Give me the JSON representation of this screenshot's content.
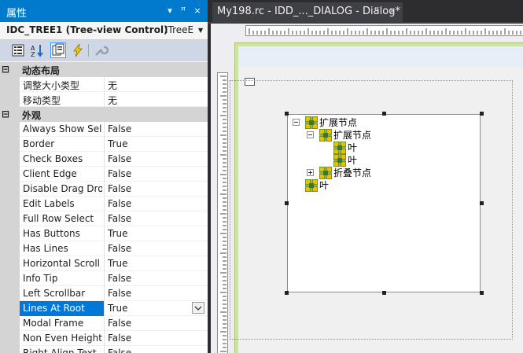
{
  "properties_panel": {
    "title": "属性",
    "title_buttons": {
      "dropdown": "▾",
      "pin": "ꟸ",
      "close": "×"
    },
    "object_name": "IDC_TREE1 (Tree-view Control)",
    "object_type": "ITreeE",
    "categories": [
      {
        "toggle": "⊟",
        "label": "动态布局",
        "props": [
          {
            "name": "调整大小类型",
            "value": "无"
          },
          {
            "name": "移动类型",
            "value": "无"
          }
        ]
      },
      {
        "toggle": "⊟",
        "label": "外观",
        "props": [
          {
            "name": "Always Show Selection",
            "value": "False"
          },
          {
            "name": "Border",
            "value": "True"
          },
          {
            "name": "Check Boxes",
            "value": "False"
          },
          {
            "name": "Client Edge",
            "value": "False"
          },
          {
            "name": "Disable Drag Drop",
            "value": "False"
          },
          {
            "name": "Edit Labels",
            "value": "False"
          },
          {
            "name": "Full Row Select",
            "value": "False"
          },
          {
            "name": "Has Buttons",
            "value": "True"
          },
          {
            "name": "Has Lines",
            "value": "False"
          },
          {
            "name": "Horizontal Scroll",
            "value": "True"
          },
          {
            "name": "Info Tip",
            "value": "False"
          },
          {
            "name": "Left Scrollbar",
            "value": "False"
          },
          {
            "name": "Lines At Root",
            "value": "True"
          },
          {
            "name": "Modal Frame",
            "value": "False"
          },
          {
            "name": "Non Even Height",
            "value": "False"
          },
          {
            "name": "Right Align Text",
            "value": "False"
          }
        ]
      }
    ],
    "selected_property": "Lines At Root"
  },
  "editor": {
    "tab_title": "My198.rc - IDD_..._DIALOG - Dialog*",
    "tab_pin": "ꟸ",
    "tab_close": "×"
  },
  "tree_view": {
    "nodes": [
      {
        "label": "扩展节点",
        "depth": 0,
        "button": "minus"
      },
      {
        "label": "扩展节点",
        "depth": 1,
        "button": "minus"
      },
      {
        "label": "叶",
        "depth": 2,
        "button": "none"
      },
      {
        "label": "叶",
        "depth": 2,
        "button": "none"
      },
      {
        "label": "折叠节点",
        "depth": 1,
        "button": "plus"
      },
      {
        "label": "叶",
        "depth": 0,
        "button": "none"
      }
    ]
  },
  "colors": {
    "accent": "#007acc",
    "selection": "#0078d7",
    "dialog_border": "#a9c46a",
    "icon_yellow": "#e8c000",
    "icon_green": "#3c7a1e"
  }
}
